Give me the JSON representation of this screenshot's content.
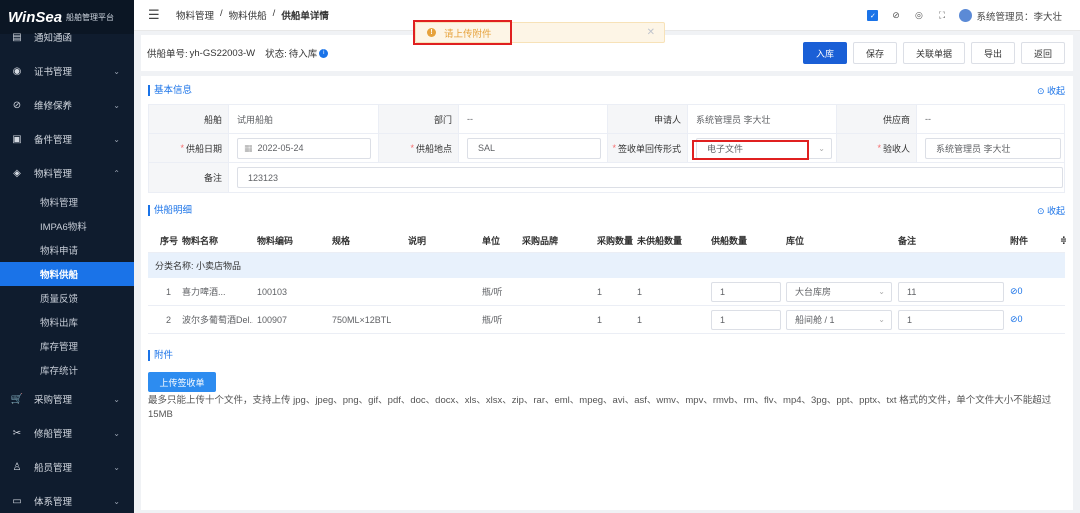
{
  "brand": {
    "name": "WinSea",
    "subtitle": "船舶管理平台"
  },
  "sidebar": {
    "items": [
      {
        "label": "通知通函",
        "icon": "notice-icon",
        "arrow": ""
      },
      {
        "label": "证书管理",
        "icon": "certificate-icon",
        "arrow": "⌄"
      },
      {
        "label": "维修保养",
        "icon": "maintenance-icon",
        "arrow": "⌄"
      },
      {
        "label": "备件管理",
        "icon": "spare-parts-icon",
        "arrow": "⌄"
      },
      {
        "label": "物料管理",
        "icon": "materials-icon",
        "arrow": "⌃"
      }
    ],
    "subitems": [
      "物料管理",
      "IMPA6物料",
      "物料申请",
      "物料供船",
      "质量反馈",
      "物料出库",
      "库存管理",
      "库存统计"
    ],
    "active_sub": "物料供船",
    "items_after": [
      {
        "label": "采购管理",
        "icon": "cart-icon",
        "arrow": "⌄"
      },
      {
        "label": "修船管理",
        "icon": "tools-icon",
        "arrow": "⌄"
      },
      {
        "label": "船员管理",
        "icon": "crew-icon",
        "arrow": "⌄"
      },
      {
        "label": "体系管理",
        "icon": "system-icon",
        "arrow": "⌄"
      }
    ]
  },
  "header": {
    "breadcrumb": [
      "物料管理",
      "物料供船",
      "供船单详情"
    ],
    "separator": "/",
    "user": "系统管理员：李大壮"
  },
  "toast": {
    "text": "请上传附件"
  },
  "order": {
    "no_label": "供船单号:",
    "no": "yh-GS22003-W",
    "status_label": "状态:",
    "status": "待入库"
  },
  "actions": {
    "stock_in": "入库",
    "save": "保存",
    "link": "关联单据",
    "export": "导出",
    "back": "返回"
  },
  "basic": {
    "title": "基本信息",
    "collapse": "收起",
    "ship_label": "船舶",
    "ship": "试用船舶",
    "dept_label": "部门",
    "dept": "--",
    "applicant_label": "申请人",
    "applicant": "系统管理员 李大壮",
    "supplier_label": "供应商",
    "supplier": "--",
    "date_label": "供船日期",
    "date": "2022-05-24",
    "place_label": "供船地点",
    "place": "SAL",
    "form_label": "签收单回传形式",
    "form": "电子文件",
    "receiver_label": "验收人",
    "receiver": "系统管理员 李大壮",
    "remark_label": "备注",
    "remark": "123123"
  },
  "detail": {
    "title": "供船明细",
    "collapse": "收起",
    "headers": [
      "序号",
      "物料名称",
      "物料编码",
      "规格",
      "说明",
      "单位",
      "采购品牌",
      "采购数量",
      "未供船数量",
      "供船数量",
      "库位",
      "备注",
      "附件"
    ],
    "category": "分类名称:  小卖店物品",
    "rows": [
      {
        "no": "1",
        "name": "喜力啤酒...",
        "code": "100103",
        "spec": "",
        "desc": "",
        "unit": "瓶/听",
        "brand": "",
        "qty": "1",
        "pending": "1",
        "supply": "1",
        "loc": "大台库房",
        "remark": "11",
        "att": "0"
      },
      {
        "no": "2",
        "name": "波尔多葡萄酒Del...",
        "code": "100907",
        "spec": "750ML×12BTL",
        "desc": "",
        "unit": "瓶/听",
        "brand": "",
        "qty": "1",
        "pending": "1",
        "supply": "1",
        "loc": "船间舱 / 1",
        "remark": "1",
        "att": "0"
      }
    ]
  },
  "attachment": {
    "title": "附件",
    "upload": "上传签收单",
    "note": "最多只能上传十个文件，支持上传 jpg、jpeg、png、gif、pdf、doc、docx、xls、xlsx、zip、rar、eml、mpeg、avi、asf、wmv、mpv、rmvb、rm、flv、mp4、3pg、ppt、pptx、txt 格式的文件，单个文件大小不能超过15MB"
  }
}
